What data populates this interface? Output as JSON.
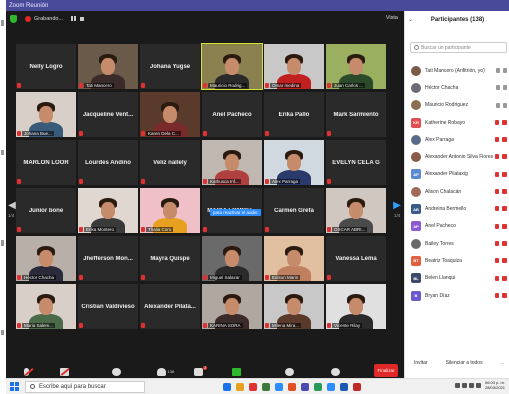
{
  "window": {
    "title": "Zoom Reunión"
  },
  "topbar": {
    "recording_label": "Grabando...",
    "view_label": "Vista"
  },
  "grid": {
    "tiles": [
      {
        "type": "name",
        "name": "Nelly Logro"
      },
      {
        "type": "video",
        "label": "Tati Mancero",
        "bg": "#6a5a4a",
        "shirt": "#3a2a2a"
      },
      {
        "type": "name",
        "name": "Johana Yugse"
      },
      {
        "type": "video",
        "label": "Mauricio Rodrig...",
        "bg": "#8a8050",
        "shirt": "#2a2a2a",
        "active": true
      },
      {
        "type": "video",
        "label": "Omar medina",
        "bg": "#c8c8c8",
        "shirt": "#c02020"
      },
      {
        "type": "video",
        "label": "Juan Carlos ...",
        "bg": "#9ab060",
        "shirt": "#2a4a2a"
      },
      {
        "type": "video",
        "label": "Johana Bue...",
        "bg": "#d8d0c8",
        "shirt": "#3a5a7a"
      },
      {
        "type": "name",
        "name": "Jacqueline Vent..."
      },
      {
        "type": "video",
        "label": "Karen Dela C...",
        "bg": "#5a3a2a",
        "shirt": "#7a2a2a"
      },
      {
        "type": "name",
        "name": "Anel Pacheco"
      },
      {
        "type": "name",
        "name": "Erika Pallo"
      },
      {
        "type": "name",
        "name": "Mark Sarmiento"
      },
      {
        "type": "name",
        "name": "MARLON LOOR"
      },
      {
        "type": "name",
        "name": "Lourdes Andino"
      },
      {
        "type": "name",
        "name": "Veliz nallely"
      },
      {
        "type": "video",
        "label": "Kathusca Inf...",
        "bg": "#c0b8b0",
        "shirt": "#b04040"
      },
      {
        "type": "video",
        "label": "Alex Parraga",
        "bg": "#d0d8e0",
        "shirt": "#2a3a6a"
      },
      {
        "type": "name",
        "name": "EVELYN CELA G"
      },
      {
        "type": "name",
        "name": "Junior bone"
      },
      {
        "type": "video",
        "label": "Erika Montero",
        "bg": "#e0d8d0",
        "shirt": "#3a3a3a"
      },
      {
        "type": "video",
        "label": "Thalia Coro",
        "bg": "#f0c0c8",
        "shirt": "#e8a020"
      },
      {
        "type": "name",
        "name": "MARÍA LOMBEI..."
      },
      {
        "type": "name",
        "name": "Carmen Grefa"
      },
      {
        "type": "video",
        "label": "OSCAR ABRI...",
        "bg": "#d0c8c0",
        "shirt": "#4a4a4a"
      },
      {
        "type": "video",
        "label": "Héctor Chacha",
        "bg": "#b8b0a8",
        "shirt": "#2a2a3a"
      },
      {
        "type": "name",
        "name": "Jhefferson Mon..."
      },
      {
        "type": "name",
        "name": "Mayra Quispe"
      },
      {
        "type": "video",
        "label": "Miguel Salazar",
        "bg": "#6a6a6a",
        "shirt": "#2a2a2a"
      },
      {
        "type": "video",
        "label": "Edison Marin",
        "bg": "#e0c0a0",
        "shirt": "#c08060"
      },
      {
        "type": "name",
        "name": "Vanessa Lema"
      },
      {
        "type": "video",
        "label": "Maria Salem...",
        "bg": "#d8d0c8",
        "shirt": "#4a6a4a"
      },
      {
        "type": "name",
        "name": "Cristian Valdivieso"
      },
      {
        "type": "name",
        "name": "Alexander Pilata..."
      },
      {
        "type": "video",
        "label": "KARINA SORA",
        "bg": "#b0a8a0",
        "shirt": "#3a2a2a"
      },
      {
        "type": "video",
        "label": "Milena Mira...",
        "bg": "#c8c8c8",
        "shirt": "#5a3a2a"
      },
      {
        "type": "video",
        "label": "Vicente Rilay",
        "bg": "#e0e0e0",
        "shirt": "#2a2a2a"
      }
    ],
    "page_left": "1/4",
    "page_right": "1/4",
    "tooltip": "para reactivar el audio"
  },
  "toolbar": {
    "mute_label": "Desactivar audio",
    "video_label": "Iniciar video",
    "security_label": "Seguridad",
    "participants_label": "Participantes",
    "participants_count": "138",
    "chat_label": "Chat",
    "chat_badge": "2",
    "share_label": "Compartir pantalla",
    "record_label": "Pausar/detener grabación",
    "reactions_label": "Reacciones",
    "end_label": "Finalizar"
  },
  "panel": {
    "title": "Participantes (138)",
    "search_placeholder": "Buscar un participante",
    "participants": [
      {
        "name": "Tati Mancero (Anfitrión, yo)",
        "avatar": "photo",
        "color": "#7a5a4a",
        "initials": ""
      },
      {
        "name": "Héctor Chacha",
        "avatar": "photo",
        "color": "#6a6a7a",
        "initials": ""
      },
      {
        "name": "Mauricio Rodriguez",
        "avatar": "photo",
        "color": "#8a7050",
        "initials": ""
      },
      {
        "name": "Katherine Robayo",
        "avatar": "initials",
        "color": "#e05050",
        "initials": "KR"
      },
      {
        "name": "Alex Parraga",
        "avatar": "photo",
        "color": "#5a6a8a",
        "initials": ""
      },
      {
        "name": "Alexander Antonio Silva Flores",
        "avatar": "photo",
        "color": "#8a5a4a",
        "initials": ""
      },
      {
        "name": "Alexander Pilataxig",
        "avatar": "initials",
        "color": "#5a8ad0",
        "initials": "AP"
      },
      {
        "name": "Alison Chalacán",
        "avatar": "photo",
        "color": "#a06a5a",
        "initials": ""
      },
      {
        "name": "Andreina Bermello",
        "avatar": "initials",
        "color": "#3a5a8a",
        "initials": "AB"
      },
      {
        "name": "Anel Pacheco",
        "avatar": "initials",
        "color": "#8a5ad0",
        "initials": "AP"
      },
      {
        "name": "Bailey Torres",
        "avatar": "photo",
        "color": "#6a6a6a",
        "initials": ""
      },
      {
        "name": "Beatriz Toaquiza",
        "avatar": "initials",
        "color": "#e06040",
        "initials": "BT"
      },
      {
        "name": "Belen Llanqui",
        "avatar": "initials",
        "color": "#3a4a6a",
        "initials": "BL"
      },
      {
        "name": "Bryan Díaz",
        "avatar": "initials",
        "color": "#6a5ad0",
        "initials": "B"
      }
    ],
    "invite_label": "Invitar",
    "mute_all_label": "Silenciar a todos",
    "more_label": "..."
  },
  "taskbar": {
    "search_placeholder": "Escribe aquí para buscar",
    "time": "06:03 p. m.",
    "date": "28/03/2021",
    "app_colors": [
      "#1a73e8",
      "#e8a020",
      "#d33",
      "#3a7a3a",
      "#2d8cff",
      "#e05020",
      "#4a4ab0",
      "#2a9a5a",
      "#2d8cff",
      "#1a5ab0",
      "#c02828"
    ]
  }
}
